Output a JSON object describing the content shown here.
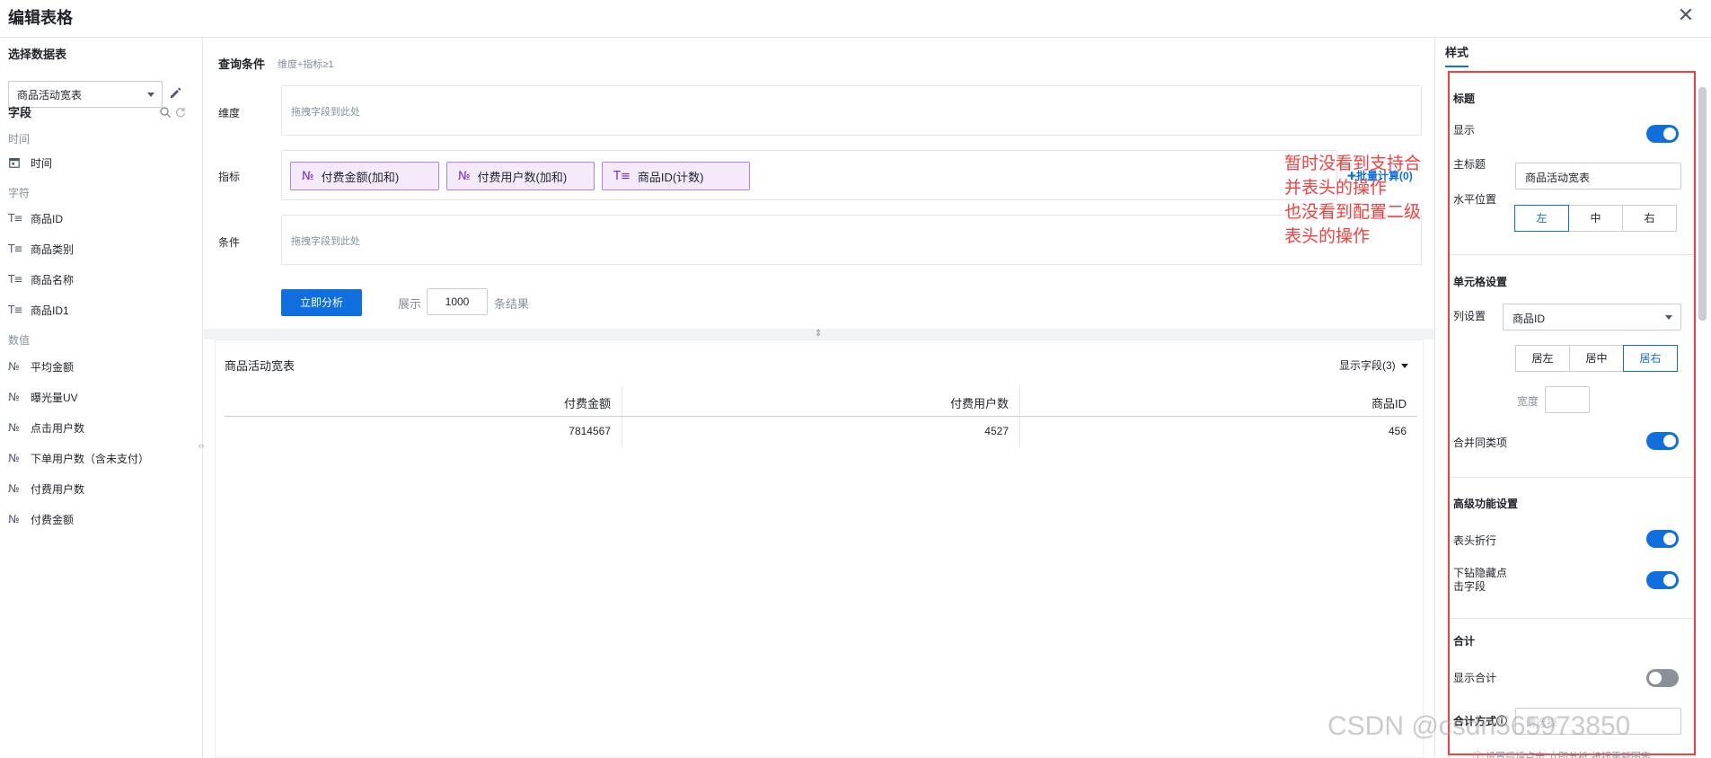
{
  "header": {
    "title": "编辑表格",
    "close_icon": "close-icon",
    "close_glyph": "✕"
  },
  "sidebar": {
    "section_title": "选择数据表",
    "selected_table": "商品活动宽表",
    "fields_title": "字段",
    "groups": {
      "time": {
        "title": "时间",
        "items": [
          {
            "label": "时间",
            "icon": "calendar-icon",
            "glyph": "📅"
          }
        ]
      },
      "text": {
        "title": "字符",
        "items": [
          {
            "label": "商品ID",
            "icon": "text-type-icon",
            "glyph": "T≡"
          },
          {
            "label": "商品类别",
            "icon": "text-type-icon",
            "glyph": "T≡"
          },
          {
            "label": "商品名称",
            "icon": "text-type-icon",
            "glyph": "T≡"
          },
          {
            "label": "商品ID1",
            "icon": "text-type-icon",
            "glyph": "T≡"
          }
        ]
      },
      "number": {
        "title": "数值",
        "items": [
          {
            "label": "平均金额",
            "icon": "number-type-icon",
            "glyph": "№"
          },
          {
            "label": "曝光量UV",
            "icon": "number-type-icon",
            "glyph": "№"
          },
          {
            "label": "点击用户数",
            "icon": "number-type-icon",
            "glyph": "№"
          },
          {
            "label": "下单用户数（含未支付）",
            "icon": "number-type-icon",
            "glyph": "№"
          },
          {
            "label": "付费用户数",
            "icon": "number-type-icon",
            "glyph": "№"
          },
          {
            "label": "付费金额",
            "icon": "number-type-icon",
            "glyph": "№"
          }
        ]
      }
    }
  },
  "query": {
    "title": "查询条件",
    "subtitle": "维度+指标≥1",
    "dimension_label": "维度",
    "dimension_placeholder": "拖拽字段到此处",
    "metric_label": "指标",
    "metrics": [
      {
        "label": "付费金额(加和)",
        "glyph": "№"
      },
      {
        "label": "付费用户数(加和)",
        "glyph": "№"
      },
      {
        "label": "商品ID(计数)",
        "glyph": "T≡"
      }
    ],
    "batch_calc": "✚批量计算(0)",
    "condition_label": "条件",
    "condition_placeholder": "拖拽字段到此处",
    "run_button": "立即分析",
    "show_label": "展示",
    "show_count": "1000",
    "show_unit": "条结果"
  },
  "annotation": {
    "line1": "暂时没看到支持合并表头的操作",
    "line2": "也没看到配置二级表头的操作"
  },
  "result": {
    "title": "商品活动宽表",
    "show_fields": "显示字段(3)",
    "columns": [
      "付费金额",
      "付费用户数",
      "商品ID"
    ],
    "rows": [
      [
        "7814567",
        "4527",
        "456"
      ]
    ]
  },
  "style_panel": {
    "tab": "样式",
    "title_section": {
      "heading": "标题",
      "show_label": "显示",
      "show_on": true,
      "main_title_label": "主标题",
      "main_title_value": "商品活动宽表",
      "align_label": "水平位置",
      "align_options": [
        "左",
        "中",
        "右"
      ],
      "align_selected": "左"
    },
    "cell_section": {
      "heading": "单元格设置",
      "column_label": "列设置",
      "column_value": "商品ID",
      "align_options": [
        "居左",
        "居中",
        "居右"
      ],
      "align_selected": "居右",
      "width_label": "宽度",
      "merge_label": "合并同类项",
      "merge_on": true
    },
    "advanced_section": {
      "heading": "高级功能设置",
      "wrap_label": "表头折行",
      "wrap_on": true,
      "drill_label_1": "下钻隐藏点",
      "drill_label_2": "击字段",
      "drill_on": true
    },
    "total_section": {
      "heading": "合计",
      "show_total_label": "显示合计",
      "show_total_on": false,
      "method_label": "合计方式ⓘ",
      "method_placeholder": "请选择"
    },
    "footer_hint": "ⓘ 设置后请点击\"立即分析\"按钮更新图表"
  },
  "watermark": "CSDN @csdn565973850"
}
